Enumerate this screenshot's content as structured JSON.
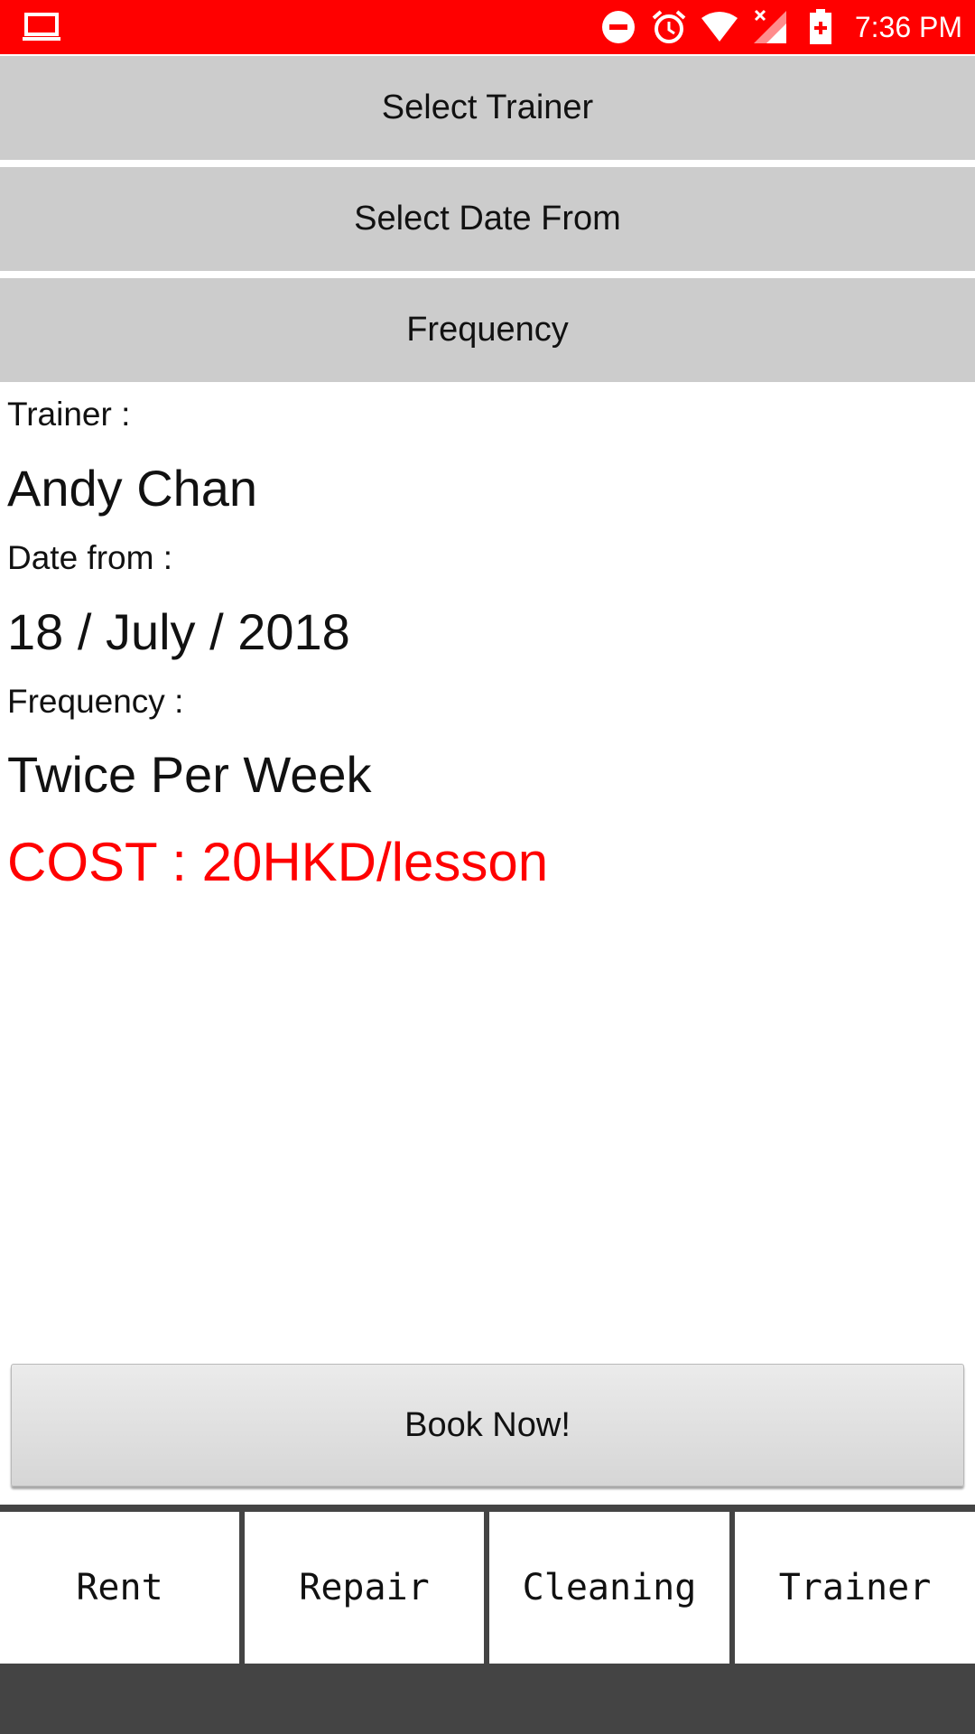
{
  "status_bar": {
    "time": "7:36 PM",
    "left_icon": "laptop-icon",
    "icons": [
      "do-not-disturb-icon",
      "alarm-icon",
      "wifi-icon",
      "signal-icon",
      "battery-icon"
    ],
    "color": "#ff0000"
  },
  "selectors": {
    "trainer_label": "Select Trainer",
    "date_label": "Select Date From",
    "frequency_label": "Frequency"
  },
  "details": {
    "trainer_label": "Trainer :",
    "trainer_value": "Andy Chan",
    "date_label": "Date from :",
    "date_value": "18 / July / 2018",
    "frequency_label": "Frequency :",
    "frequency_value": "Twice Per Week",
    "cost": "COST : 20HKD/lesson",
    "cost_color": "#ff0000"
  },
  "book_button": {
    "label": "Book Now!"
  },
  "tabs": [
    {
      "label": "Rent"
    },
    {
      "label": "Repair"
    },
    {
      "label": "Cleaning"
    },
    {
      "label": "Trainer"
    }
  ]
}
